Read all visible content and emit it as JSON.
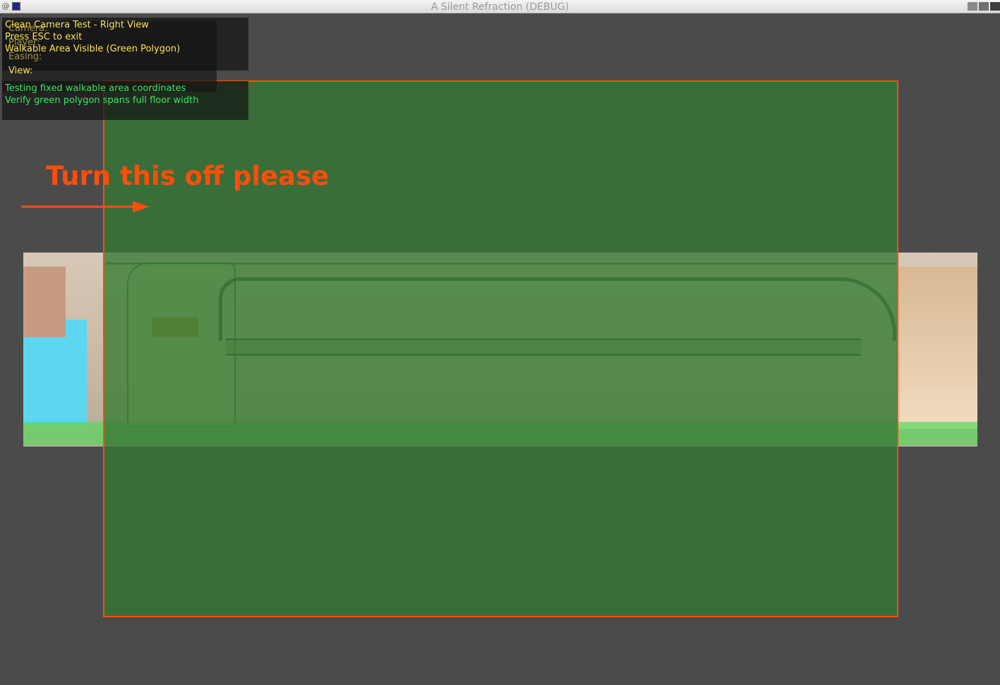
{
  "window": {
    "title": "A Silent Refraction (DEBUG)"
  },
  "debug_overlay": {
    "header_lines": [
      "Clean Camera Test - Right View",
      "Press ESC to exit",
      "Walkable Area Visible (Green Polygon)"
    ],
    "background_labels": [
      "Camera:",
      "Player:",
      "Easing:",
      "View:"
    ],
    "status_lines": [
      "Testing fixed walkable area coordinates",
      "Verify green polygon spans full floor width"
    ]
  },
  "annotation": {
    "text": "Turn this off please",
    "color": "#ff4d0a"
  },
  "colors": {
    "walkable_overlay": "#347834",
    "floor_highlight": "#5ad75a",
    "debug_text_yellow": "#ffe14d",
    "debug_text_green": "#34e85a"
  }
}
